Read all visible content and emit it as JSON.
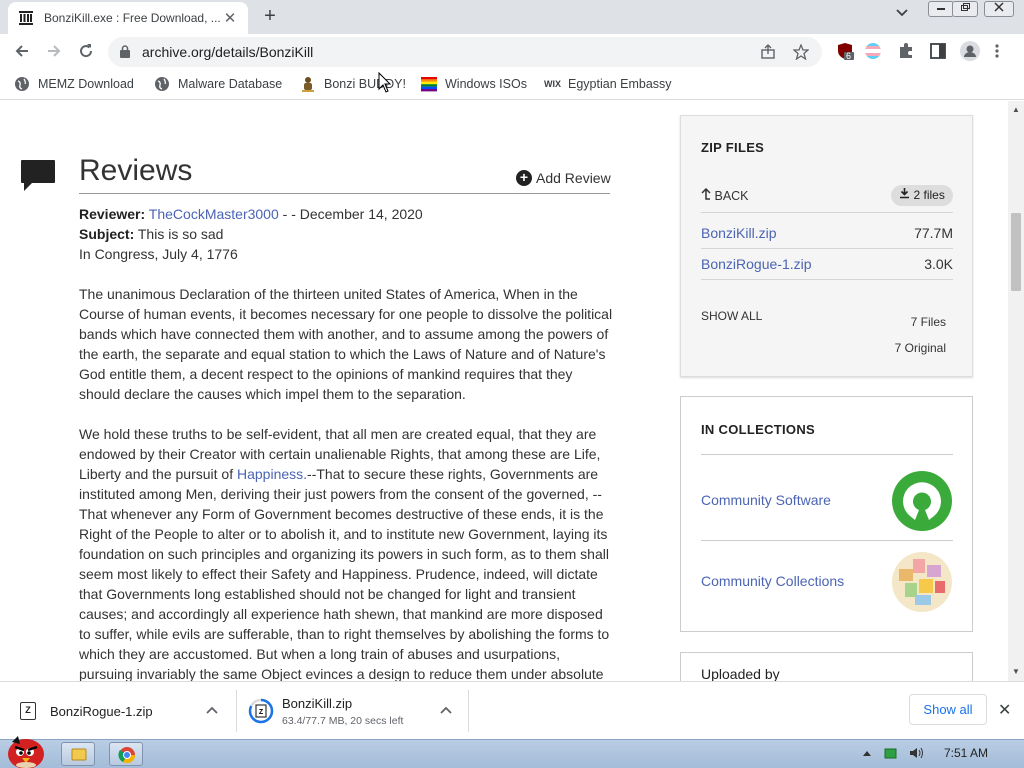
{
  "browser": {
    "tab_title": "BonziKill.exe : Free Download, ...",
    "tab_close": "✕",
    "new_tab": "+",
    "url": "archive.org/details/BonziKill",
    "extension_badge": "6"
  },
  "bookmarks": [
    {
      "label": "MEMZ Download",
      "icon": "globe-icon"
    },
    {
      "label": "Malware Database",
      "icon": "globe-icon"
    },
    {
      "label": "Bonzi BUDDY!",
      "icon": "bonzi-icon"
    },
    {
      "label": "Windows ISOs",
      "icon": "rainbow-flag-icon"
    },
    {
      "label": "Egyptian Embassy",
      "icon": "wix-icon"
    }
  ],
  "reviews": {
    "title": "Reviews",
    "add_review": "Add Review",
    "reviewer_label": "Reviewer:",
    "reviewer_name": "TheCockMaster3000",
    "review_date": "- - December 14, 2020",
    "subject_label": "Subject:",
    "subject": "This is so sad",
    "line3": "In Congress, July 4, 1776",
    "para1": "The unanimous Declaration of the thirteen united States of America, When in the Course of human events, it becomes necessary for one people to dissolve the political bands which have connected them with another, and to assume among the powers of the earth, the separate and equal station to which the Laws of Nature and of Nature's God entitle them, a decent respect to the opinions of mankind requires that they should declare the causes which impel them to the separation.",
    "para2_before": "We hold these truths to be self-evident, that all men are created equal, that they are endowed by their Creator with certain unalienable Rights, that among these are Life, Liberty and the pursuit of ",
    "para2_link": "Happiness.",
    "para2_after": "--That to secure these rights, Governments are instituted among Men, deriving their just powers from the consent of the governed, --That whenever any Form of Government becomes destructive of these ends, it is the Right of the People to alter or to abolish it, and to institute new Government, laying its foundation on such principles and organizing its powers in such form, as to them shall seem most likely to effect their Safety and Happiness. Prudence, indeed, will dictate that Governments long established should not be changed for light and transient causes; and accordingly all experience hath shewn, that mankind are more disposed to suffer, while evils are sufferable, than to right themselves by abolishing the forms to which they are accustomed. But when a long train of abuses and usurpations, pursuing invariably the same Object evinces a design to reduce them under absolute"
  },
  "zip": {
    "header": "ZIP FILES",
    "back": "BACK",
    "files_button": "2 files",
    "files": [
      {
        "name": "BonziKill.zip",
        "size": "77.7M"
      },
      {
        "name": "BonziRogue-1.zip",
        "size": "3.0K"
      }
    ],
    "show_all": "SHOW ALL",
    "total_files": "7 Files",
    "original": "7 Original"
  },
  "collections": {
    "header": "IN COLLECTIONS",
    "items": [
      {
        "label": "Community Software",
        "icon": "open-source-icon"
      },
      {
        "label": "Community Collections",
        "icon": "collections-icon"
      }
    ]
  },
  "uploaded_by": "Uploaded by",
  "downloads": {
    "items": [
      {
        "name": "BonziRogue-1.zip",
        "status": ""
      },
      {
        "name": "BonziKill.zip",
        "status": "63.4/77.7 MB, 20 secs left",
        "progress": 0.82
      }
    ],
    "show_all": "Show all",
    "close": "✕"
  },
  "taskbar": {
    "time": "7:51 AM"
  },
  "colors": {
    "link": "#4b64b4",
    "chrome_tabstrip": "#dee1e6",
    "taskbar": "#b9cde4"
  }
}
